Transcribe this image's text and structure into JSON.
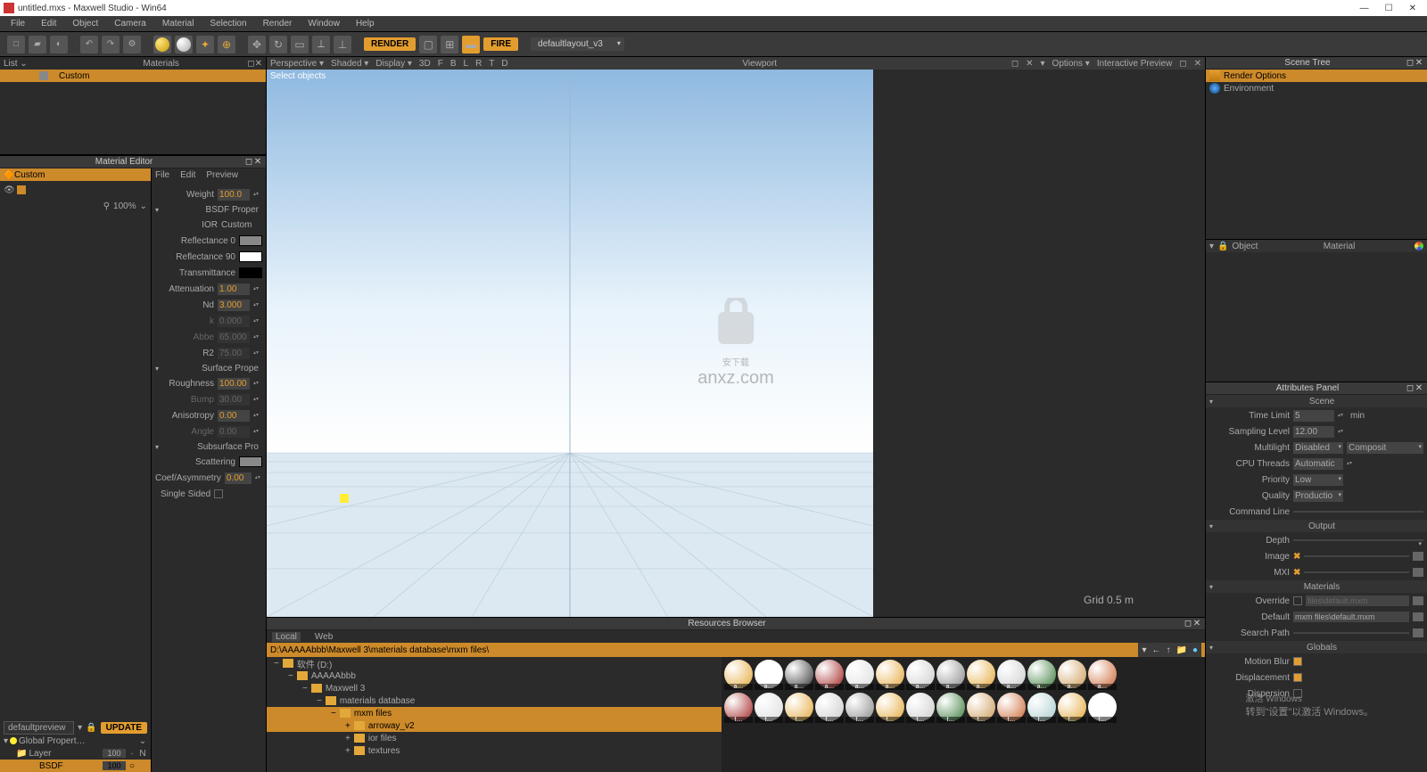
{
  "title": "untitled.mxs - Maxwell Studio - Win64",
  "winbtns": {
    "min": "—",
    "max": "☐",
    "close": "✕"
  },
  "menu": [
    "File",
    "Edit",
    "Object",
    "Camera",
    "Material",
    "Selection",
    "Render",
    "Window",
    "Help"
  ],
  "toolbar": {
    "render": "RENDER",
    "fire": "FIRE",
    "layout": "defaultlayout_v3",
    "icons": [
      "□",
      "▰",
      "◐",
      "↶",
      "↷",
      "⚙"
    ]
  },
  "list": {
    "title_left": "List",
    "title_right": "Materials",
    "row": "Custom",
    "dropdown": "⌄",
    "popout": "◻",
    "close": "✕"
  },
  "materialeditor": {
    "title": "Material Editor",
    "menu": [
      "File",
      "Edit",
      "Preview"
    ],
    "custom": "Custom",
    "zoom": "100%",
    "search_icon": "⚲",
    "preview_sel": "defaultpreview",
    "update": "UPDATE",
    "tree": {
      "global": "Global Propert…",
      "layer": "Layer",
      "layer_val": "100",
      "layer_e": "N",
      "bsdf": "BSDF",
      "bsdf_val": "100"
    },
    "props": {
      "weight_lbl": "Weight",
      "weight": "100.0",
      "sec_bsdf": "BSDF Proper",
      "ior_lbl": "IOR",
      "ior": "Custom",
      "refl0_lbl": "Reflectance 0",
      "refl90_lbl": "Reflectance 90",
      "trans_lbl": "Transmittance",
      "att_lbl": "Attenuation",
      "att": "1.00",
      "nd_lbl": "Nd",
      "nd": "3.000",
      "k_lbl": "k",
      "k": "0.000",
      "abbe_lbl": "Abbe",
      "abbe": "65.000",
      "r2_lbl": "R2",
      "r2": "75.00",
      "sec_surface": "Surface Prope",
      "rough_lbl": "Roughness",
      "rough": "100.00",
      "bump_lbl": "Bump",
      "bump": "30.00",
      "aniso_lbl": "Anisotropy",
      "aniso": "0.00",
      "angle_lbl": "Angle",
      "angle": "0.00",
      "sec_sss": "Subsurface Pro",
      "scatter_lbl": "Scattering",
      "coef_lbl": "Coef/Asymmetry",
      "coef": "0.00",
      "single_lbl": "Single Sided"
    }
  },
  "viewport": {
    "head": {
      "persp": "Perspective ▾",
      "shaded": "Shaded ▾",
      "display": "Display ▾",
      "flags": [
        "3D",
        "F",
        "B",
        "L",
        "R",
        "T",
        "D"
      ],
      "title": "Viewport",
      "options": "Options ▾",
      "ipr": "Interactive Preview"
    },
    "hint_label": "Select objects",
    "grid_label": "Grid  0.5 m",
    "watermark_top": "安下载",
    "watermark_bottom": "anxz.com"
  },
  "resbrowser": {
    "title": "Resources Browser",
    "tabs": {
      "local": "Local",
      "web": "Web"
    },
    "path": "D:\\AAAAAbbb\\Maxwell 3\\materials database\\mxm files\\",
    "navicons": [
      "←",
      "↑",
      "📁",
      "●"
    ],
    "tree": [
      {
        "lvl": 0,
        "label": "软件 (D:)",
        "on": false
      },
      {
        "lvl": 1,
        "label": "AAAAAbbb",
        "on": false
      },
      {
        "lvl": 2,
        "label": "Maxwell 3",
        "on": false
      },
      {
        "lvl": 3,
        "label": "materials database",
        "on": false
      },
      {
        "lvl": 4,
        "label": "mxm files",
        "on": true
      },
      {
        "lvl": 5,
        "label": "arroway_v2",
        "on": true
      },
      {
        "lvl": 5,
        "label": "ior files",
        "on": false
      },
      {
        "lvl": 5,
        "label": "textures",
        "on": false
      }
    ]
  },
  "scenetree": {
    "title": "Scene Tree",
    "render_options": "Render Options",
    "environment": "Environment"
  },
  "objmat": {
    "lock": "🔒",
    "object": "Object",
    "material": "Material"
  },
  "attrpanel": {
    "title": "Attributes Panel",
    "scene": {
      "title": "Scene",
      "time_limit_lbl": "Time Limit",
      "time_limit": "5",
      "time_unit": "min",
      "sampling_lbl": "Sampling Level",
      "sampling": "12.00",
      "multilight_lbl": "Multilight",
      "multilight": "Disabled",
      "composite": "Composit",
      "cpu_lbl": "CPU Threads",
      "cpu": "Automatic",
      "priority_lbl": "Priority",
      "priority": "Low",
      "quality_lbl": "Quality",
      "quality": "Productio",
      "cmd_lbl": "Command Line"
    },
    "output": {
      "title": "Output",
      "depth_lbl": "Depth",
      "image_lbl": "Image",
      "x": "✖",
      "mxi_lbl": "MXI"
    },
    "materials": {
      "title": "Materials",
      "override_lbl": "Override",
      "override": "files\\default.mxm",
      "default_lbl": "Default",
      "default": "mxm files\\default.mxm",
      "search_lbl": "Search Path"
    },
    "globals": {
      "title": "Globals",
      "motion_lbl": "Motion Blur",
      "disp_lbl": "Displacement",
      "dispn_lbl": "Dispersion"
    }
  },
  "activate": {
    "line1": "激活 Windows",
    "line2": "转到\"设置\"以激活 Windows。"
  }
}
